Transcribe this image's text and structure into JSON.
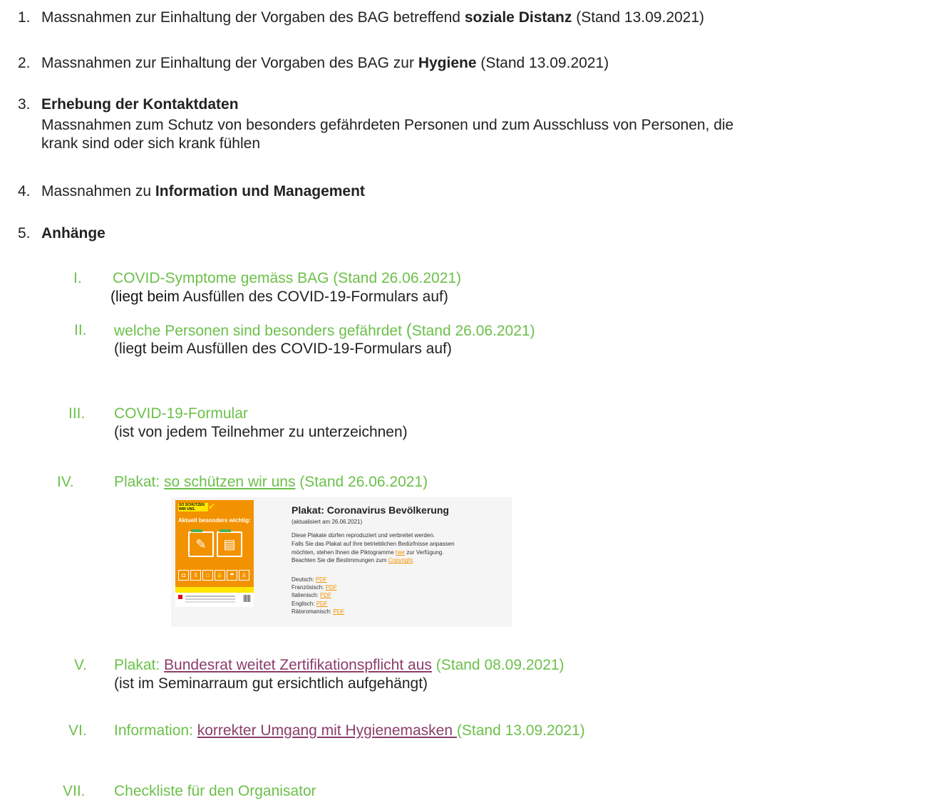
{
  "items": [
    {
      "num": "1.",
      "pre": "Massnahmen zur Einhaltung der Vorgaben des BAG betreffend ",
      "bold": "soziale Distanz",
      "post": " (Stand 13.09.2021)"
    },
    {
      "num": "2.",
      "pre": "Massnahmen zur Einhaltung der Vorgaben des BAG zur ",
      "bold": "Hygiene",
      "post": " (Stand 13.09.2021)"
    },
    {
      "num": "3.",
      "bold": "Erhebung der Kontaktdaten",
      "line2": "Massnahmen zum Schutz von besonders gefährdeten Personen und zum Ausschluss von Personen, die",
      "line3": "krank sind oder sich krank fühlen"
    },
    {
      "num": "4.",
      "pre": "Massnahmen zu ",
      "bold": "Information und Management"
    },
    {
      "num": "5.",
      "bold": "Anhänge"
    }
  ],
  "appendix": [
    {
      "num": "I.",
      "text": "COVID-Symptome gemäss BAG (Stand 26.06.2021)",
      "note_dark": "(liegt beim",
      "note_rest": " Ausfüllen des COVID-19-Formulars auf)"
    },
    {
      "num": "II.",
      "text": "welche Personen sind besonders gefährdet",
      "paren": "(",
      "text_after": "Stand 26.06.2021)",
      "note": "(liegt beim Ausfüllen des COVID-19-Formulars auf)"
    },
    {
      "num": "III.",
      "text": "COVID-19-Formular",
      "note": "(ist von jedem Teilnehmer zu unterzeichnen)"
    },
    {
      "num": "IV.",
      "prefix": "Plakat: ",
      "link": "so schützen wir uns",
      "suffix": " (Stand 26.06.2021)"
    },
    {
      "num": "V.",
      "prefix": "Plakat: ",
      "link": "Bundesrat weitet Zertifikationspflicht aus",
      "suffix": " (Stand 08.09.2021)",
      "note": "(ist im Seminarraum gut ersichtlich aufgehängt)"
    },
    {
      "num": "VI.",
      "prefix": "Information: ",
      "link": "korrekter Umgang mit Hygienemasken ",
      "suffix": "(Stand 13.09.2021)"
    },
    {
      "num": "VII.",
      "text": "Checkliste für den Organisator"
    }
  ],
  "poster_screenshot": {
    "poster_tag": "SO SCHÜTZEN WIR UNS.",
    "poster_headline": "Aktuell besonders wichtig:",
    "title": "Plakat: Coronavirus Bevölkerung",
    "date": "(aktualisiert am 26.06.2021)",
    "p1": "Diese Plakate dürfen reproduziert und verbreitet werden.",
    "p2": "Falls Sie das Plakat auf Ihre betrieblichen Bedürfnisse anpassen",
    "p3a": "möchten, stehen Ihnen die Piktogramme ",
    "p3link": "hier",
    "p3b": " zur Verfügung.",
    "p4a": "Beachten Sie die Bestimmungen zum ",
    "p4link": "Copyright",
    "p4b": ".",
    "languages": [
      {
        "label": "Deutsch: ",
        "link": "PDF"
      },
      {
        "label": "Französisch: ",
        "link": "PDF"
      },
      {
        "label": "Italienisch: ",
        "link": "PDF"
      },
      {
        "label": "Englisch: ",
        "link": "PDF"
      },
      {
        "label": "Rätoromanisch: ",
        "link": "PDF"
      }
    ]
  },
  "colors": {
    "green": "#6cc04a",
    "plum": "#8b3d6b",
    "orange": "#f39200",
    "yellow": "#ffe600"
  }
}
